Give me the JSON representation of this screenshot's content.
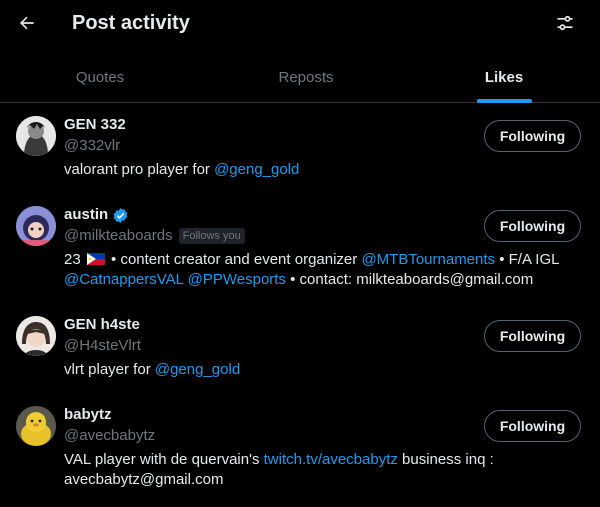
{
  "header": {
    "title": "Post activity",
    "back_icon": "arrow-left-icon",
    "filter_icon": "sliders-icon"
  },
  "tabs": [
    {
      "label": "Quotes",
      "active": false
    },
    {
      "label": "Reposts",
      "active": false
    },
    {
      "label": "Likes",
      "active": true
    }
  ],
  "colors": {
    "background": "#000000",
    "accent": "#1d9bf0",
    "verified": "#1d9bf0",
    "muted": "#71767b"
  },
  "users": [
    {
      "name": "GEN 332",
      "handle": "@332vlr",
      "verified": false,
      "follows_you": "",
      "bio_prefix": "valorant pro player for ",
      "bio_mention": "@geng_gold",
      "follow_label": "Following"
    },
    {
      "name": "austin",
      "handle": "@milkteaboards",
      "verified": true,
      "follows_you": "Follows you",
      "bio_line1_prefix": "23",
      "bio_line1_mid": " • content creator and event organizer ",
      "bio_line1_mention": "@MTBTournaments",
      "bio_line1_suffix": " • F/A IGL",
      "bio_line2_mention1": "@CatnappersVAL",
      "bio_line2_mention2": "@PPWesports",
      "bio_line2_suffix": " • contact: milkteaboards@gmail.com",
      "follow_label": "Following"
    },
    {
      "name": "GEN h4ste",
      "handle": "@H4steVlrt",
      "verified": false,
      "follows_you": "",
      "bio_prefix": "vlrt player for ",
      "bio_mention": "@geng_gold",
      "follow_label": "Following"
    },
    {
      "name": "babytz",
      "handle": "@avecbabytz",
      "verified": false,
      "follows_you": "",
      "bio_prefix": "VAL player with de quervain's ",
      "bio_link": "twitch.tv/avecbabytz",
      "bio_suffix": " business inq :",
      "bio_line2": "avecbabytz@gmail.com",
      "follow_label": "Following"
    }
  ]
}
